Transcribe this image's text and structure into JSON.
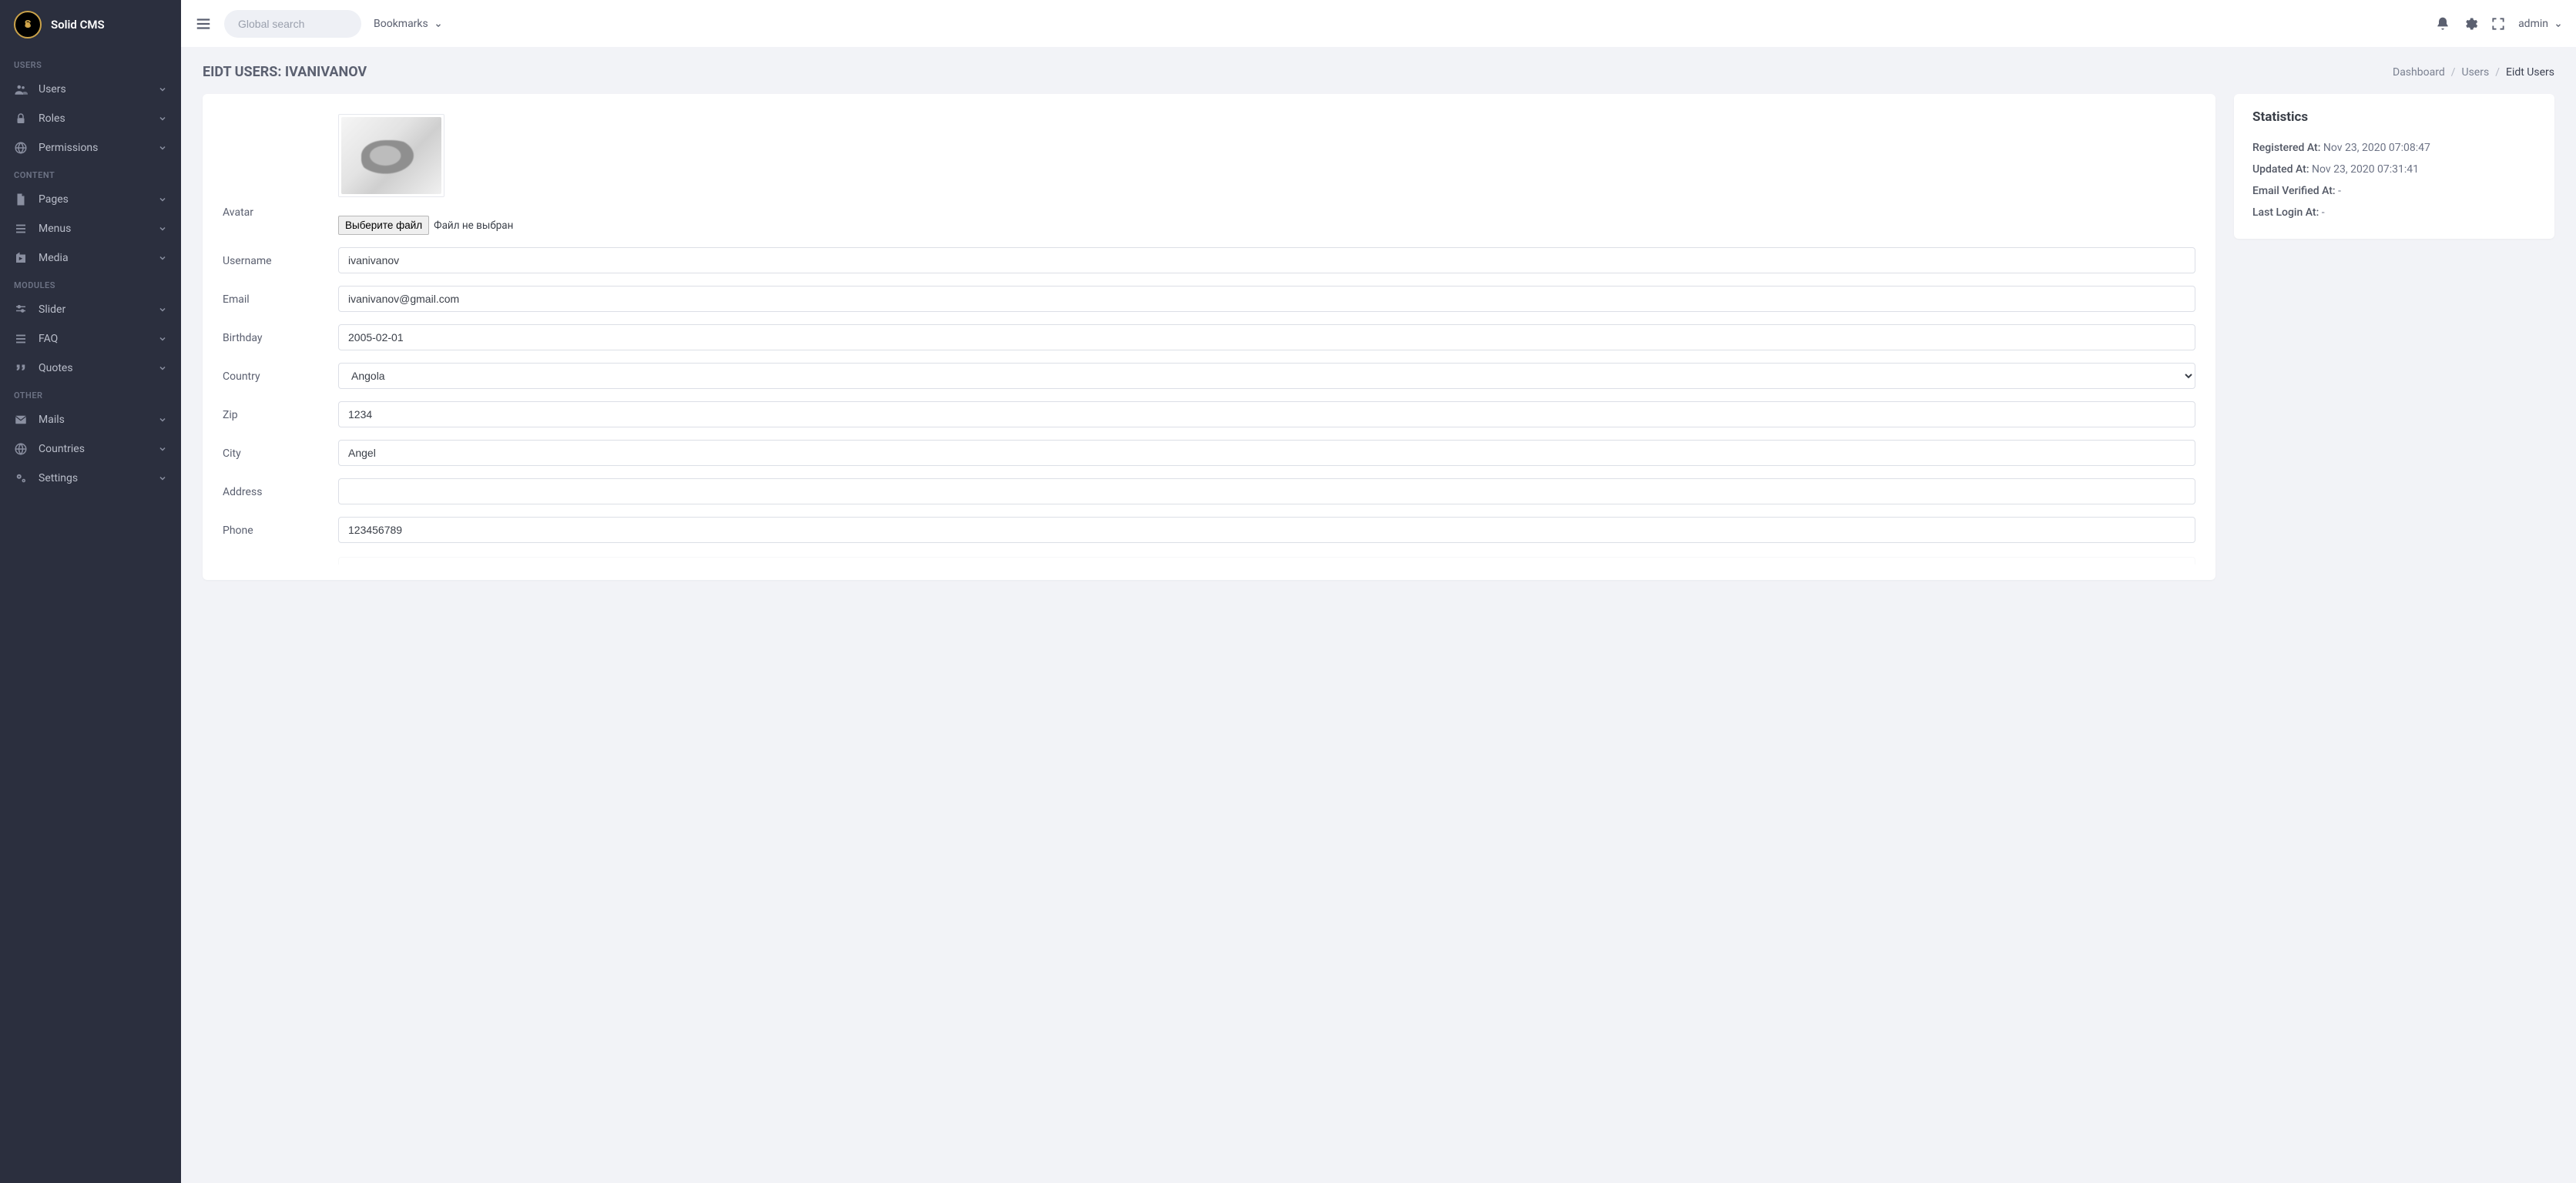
{
  "brand": {
    "name": "Solid CMS",
    "logo_letter": "S"
  },
  "sidebar": {
    "groups": [
      {
        "heading": "USERS",
        "items": [
          {
            "label": "Users",
            "icon": "users-icon"
          },
          {
            "label": "Roles",
            "icon": "lock-icon"
          },
          {
            "label": "Permissions",
            "icon": "globe-icon"
          }
        ]
      },
      {
        "heading": "CONTENT",
        "items": [
          {
            "label": "Pages",
            "icon": "file-icon"
          },
          {
            "label": "Menus",
            "icon": "list-icon"
          },
          {
            "label": "Media",
            "icon": "media-icon"
          }
        ]
      },
      {
        "heading": "MODULES",
        "items": [
          {
            "label": "Slider",
            "icon": "sliders-icon"
          },
          {
            "label": "FAQ",
            "icon": "list-icon"
          },
          {
            "label": "Quotes",
            "icon": "quote-icon"
          }
        ]
      },
      {
        "heading": "OTHER",
        "items": [
          {
            "label": "Mails",
            "icon": "mail-icon"
          },
          {
            "label": "Countries",
            "icon": "globe2-icon"
          },
          {
            "label": "Settings",
            "icon": "gears-icon"
          }
        ]
      }
    ]
  },
  "topbar": {
    "search_placeholder": "Global search",
    "bookmarks_label": "Bookmarks",
    "user_label": "admin"
  },
  "page": {
    "title": "EIDT USERS: IVANIVANOV",
    "breadcrumb": [
      {
        "label": "Dashboard",
        "active": false
      },
      {
        "label": "Users",
        "active": false
      },
      {
        "label": "Eidt Users",
        "active": true
      }
    ]
  },
  "form": {
    "avatar_label": "Avatar",
    "file_button": "Выберите файл",
    "file_status": "Файл не выбран",
    "username_label": "Username",
    "username_value": "ivanivanov",
    "email_label": "Email",
    "email_value": "ivanivanov@gmail.com",
    "birthday_label": "Birthday",
    "birthday_value": "2005-02-01",
    "country_label": "Country",
    "country_value": "Angola",
    "zip_label": "Zip",
    "zip_value": "1234",
    "city_label": "City",
    "city_value": "Angel",
    "address_label": "Address",
    "address_value": "",
    "phone_label": "Phone",
    "phone_value": "123456789"
  },
  "stats": {
    "title": "Statistics",
    "rows": [
      {
        "label": "Registered At:",
        "value": "Nov 23, 2020 07:08:47"
      },
      {
        "label": "Updated At:",
        "value": "Nov 23, 2020 07:31:41"
      },
      {
        "label": "Email Verified At:",
        "value": "-"
      },
      {
        "label": "Last Login At:",
        "value": "-"
      }
    ]
  }
}
